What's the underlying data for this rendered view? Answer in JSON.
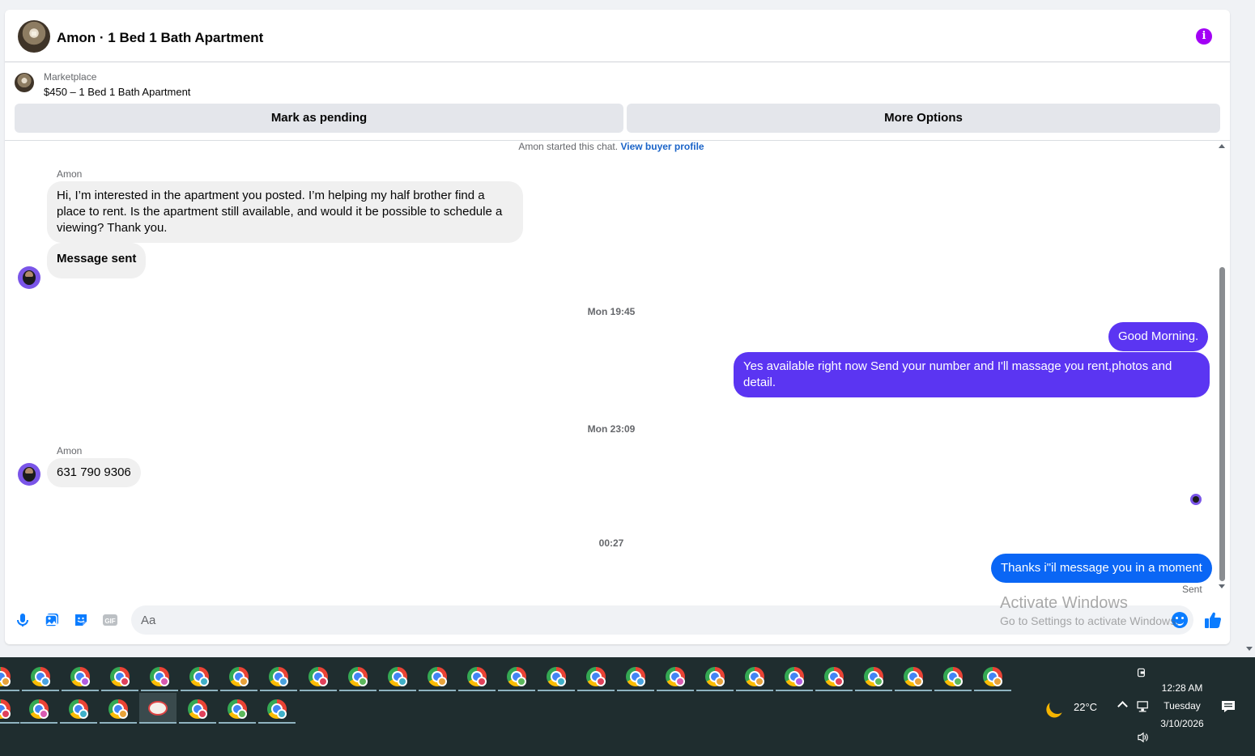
{
  "header": {
    "title": "Amon · 1 Bed 1 Bath Apartment",
    "info_icon": "info-icon"
  },
  "listing": {
    "label": "Marketplace",
    "name": "$450 – 1 Bed 1 Bath Apartment",
    "mark_pending": "Mark as pending",
    "more_options": "More Options"
  },
  "messages": {
    "started_text": "Amon started this chat.",
    "view_profile": "View buyer profile",
    "sender": "Amon",
    "msg1": "Hi, I’m interested in the apartment you posted. I’m helping my half brother find a place to rent. Is the apartment still available, and would it be possible to schedule a viewing? Thank you.",
    "msg2": "Message sent",
    "time1": "Mon 19:45",
    "out1": "Good Morning.",
    "out2": "Yes available right now Send your number and I'll massage you rent,photos and detail.",
    "time2": "Mon 23:09",
    "msg3": "631 790 9306",
    "time3": "00:27",
    "out3": "Thanks i\"il message you in a moment",
    "sent_status": "Sent"
  },
  "composer": {
    "placeholder": "Aa",
    "icons": [
      "microphone-icon",
      "photo-icon",
      "sticker-icon",
      "gif-icon",
      "emoji-icon",
      "like-icon"
    ],
    "gif_label": "GIF"
  },
  "watermark": {
    "line1": "Activate Windows",
    "line2": "Go to Settings to activate Windows."
  },
  "taskbar": {
    "weather_icon": "moon-icon",
    "temperature": "22°C",
    "time": "12:28 AM",
    "day": "Tuesday",
    "date": "3/10/2026"
  },
  "colors": {
    "outgoing_purple": "#5b35f2",
    "outgoing_blue": "#0a66f5",
    "accent_info": "#a200f5",
    "link": "#1b64c8"
  }
}
